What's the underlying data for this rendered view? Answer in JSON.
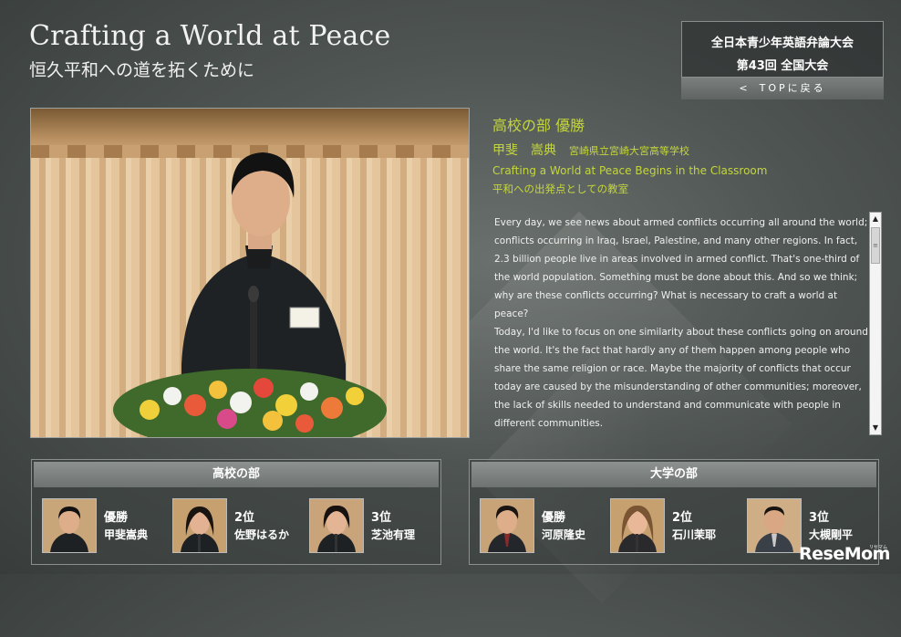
{
  "header": {
    "title_en": "Crafting a World at Peace",
    "title_ja": "恒久平和への道を拓くために"
  },
  "event": {
    "line1": "全日本青少年英語弁論大会",
    "line2": "第43回 全国大会",
    "top_button": "TOPに戻る",
    "top_chevron": "<"
  },
  "speech": {
    "category_award": "高校の部 優勝",
    "speaker": "甲斐　嵩典",
    "school": "宮崎県立宮崎大宮高等学校",
    "title_en": "Crafting a World at Peace Begins in the Classroom",
    "title_ja": "平和への出発点としての教室",
    "text": "Every day, we see news about armed conflicts occurring all around the world; conflicts occurring in Iraq, Israel, Palestine, and many other regions.  In fact, 2.3 billion people live in areas involved in armed conflict.  That's one-third of the world population.  Something must be done about this.  And so we think; why are these conflicts occurring?  What is necessary to craft a world at peace?\nToday, I'd like to focus on one similarity about these conflicts going on around the world.  It's the fact that hardly any of them happen among people who share the same religion or race.  Maybe the majority of conflicts that occur today are caused by the misunderstanding of other communities; moreover, the lack of skills needed to understand and communicate with people in different communities."
  },
  "scrollbar": {
    "up": "▲",
    "down": "▼",
    "thumb": "≡"
  },
  "high_school": {
    "heading": "高校の部",
    "winners": [
      {
        "rank": "優勝",
        "name": "甲斐嵩典"
      },
      {
        "rank": "2位",
        "name": "佐野はるか"
      },
      {
        "rank": "3位",
        "name": "芝池有理"
      }
    ]
  },
  "university": {
    "heading": "大学の部",
    "winners": [
      {
        "rank": "優勝",
        "name": "河原隆史"
      },
      {
        "rank": "2位",
        "name": "石川茉耶"
      },
      {
        "rank": "3位",
        "name": "大槻剛平"
      }
    ]
  },
  "watermark": {
    "logo": "ReseMom",
    "sub": "リセマム"
  },
  "colors": {
    "accent": "#c4d63c",
    "background": "#4f5553"
  }
}
